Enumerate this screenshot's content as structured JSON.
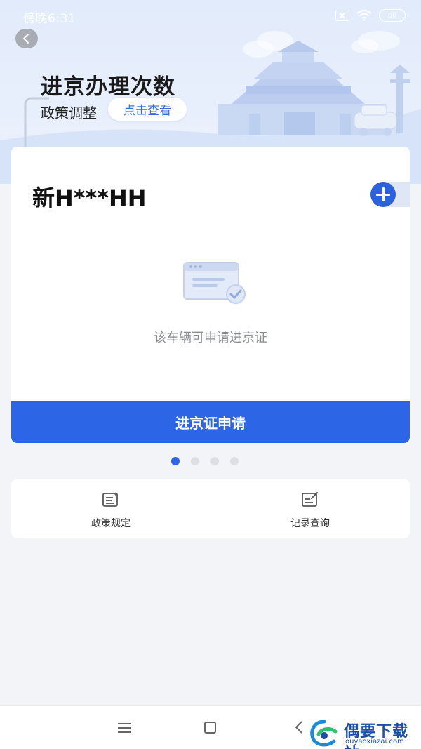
{
  "status_bar": {
    "time": "傍晚6:31",
    "battery": "60"
  },
  "banner": {
    "title": "进京办理次数",
    "subtitle": "政策调整",
    "view_button": "点击查看"
  },
  "vehicle_card": {
    "plate": "新H***HH",
    "empty_message": "该车辆可申请进京证",
    "apply_button": "进京证申请"
  },
  "pager": {
    "count": 4,
    "active_index": 0
  },
  "shortcuts": [
    {
      "label": "政策规定",
      "icon": "policy-document-icon"
    },
    {
      "label": "记录查询",
      "icon": "record-edit-icon"
    }
  ],
  "watermark": {
    "title": "偶要下载站",
    "url": "ouyaoxiazai.com"
  },
  "colors": {
    "primary": "#2c65e6",
    "banner_bg": "#e2ebfb",
    "page_bg": "#f3f4f8",
    "muted_text": "#8a8d94"
  }
}
